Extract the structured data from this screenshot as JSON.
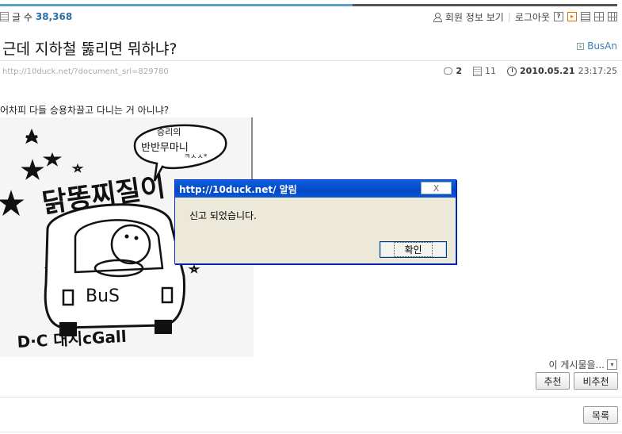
{
  "header": {
    "post_count_label": "글 수",
    "post_count": "38,368",
    "user_menu": {
      "member_info": "회원 정보 보기",
      "logout": "로그아웃"
    }
  },
  "post": {
    "title": "근데 지하철 뚫리면 뭐하냐?",
    "author": "BusAn",
    "url": "http://10duck.net/?document_srl=829780",
    "comments": "2",
    "views": "11",
    "date": "2010.05.21",
    "time": "23:17:25",
    "body": "어차피 다들 승용차끌고 다니는 거 아니냐?",
    "artwork_text": {
      "speech": "승리의 반반무마니",
      "sign": "닭똥찌질이",
      "plate": "BUS",
      "caption": "D·C 대시cGall"
    }
  },
  "actions": {
    "report_label": "이 게시물을...",
    "recommend": "추천",
    "not_recommend": "비추천",
    "list": "목록"
  },
  "dialog": {
    "title": "http://10duck.net/ 알림",
    "message": "신고 되었습니다.",
    "ok": "확인",
    "close": "X"
  }
}
